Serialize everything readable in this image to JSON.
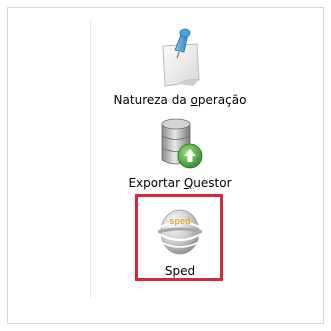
{
  "panel": {
    "items": [
      {
        "id": "natureza",
        "label_before": "Natureza da ",
        "label_mnemonic": "o",
        "label_after": "peração",
        "icon": "sticky-note-pin-icon"
      },
      {
        "id": "exportar",
        "label_before": "Exportar ",
        "label_mnemonic": "Q",
        "label_after": "uestor",
        "icon": "database-export-icon"
      },
      {
        "id": "sped",
        "label": "Sped",
        "icon": "sped-globe-icon",
        "selected": true
      }
    ]
  },
  "colors": {
    "selection_border": "#d9263a",
    "panel_border": "#d6d6d6",
    "database_green": "#3aa33a"
  }
}
